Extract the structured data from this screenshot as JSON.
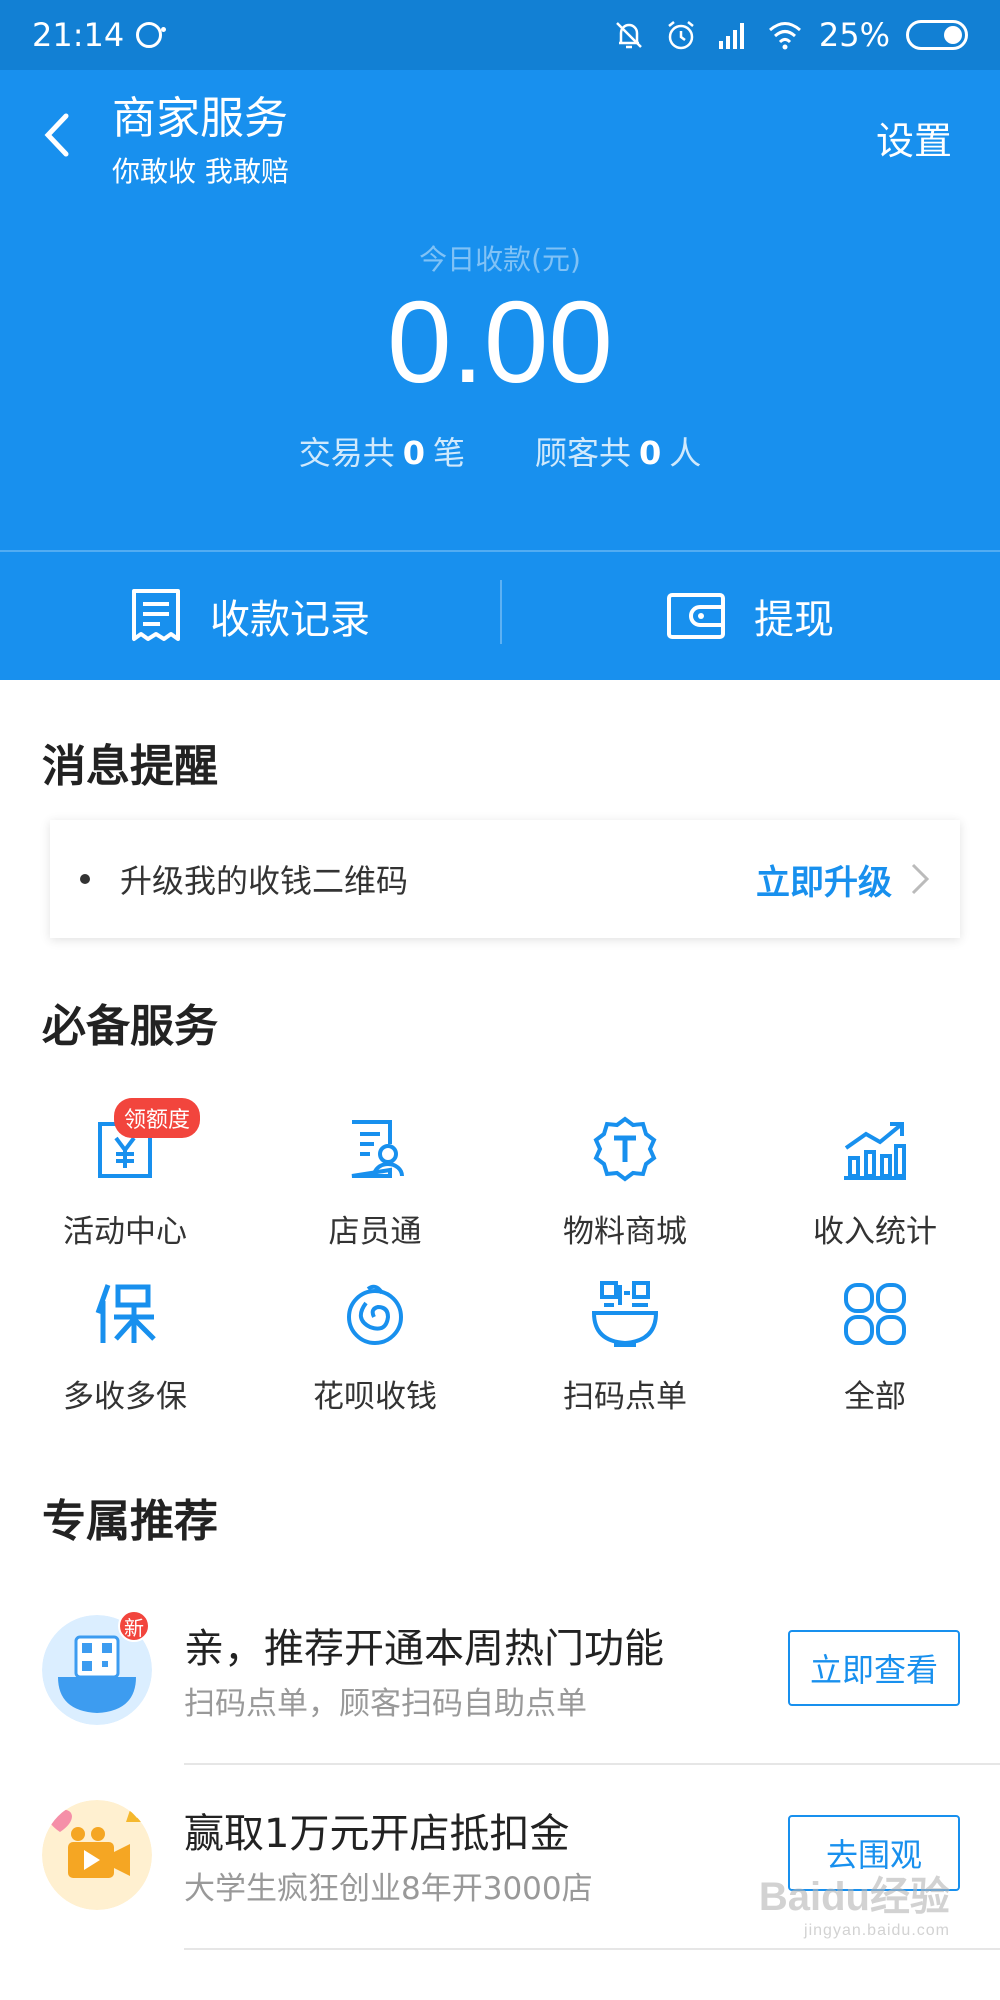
{
  "status_bar": {
    "time": "21:14",
    "battery": "25%"
  },
  "header": {
    "title": "商家服务",
    "subtitle": "你敢收 我敢赔",
    "settings_label": "设置",
    "today_label": "今日收款(元)",
    "amount": "0.00",
    "stats": {
      "trade_prefix": "交易共",
      "trade_count": "0",
      "trade_unit": "笔",
      "customer_prefix": "顾客共",
      "customer_count": "0",
      "customer_unit": "人"
    },
    "actions": [
      {
        "label": "收款记录",
        "icon": "receipt-icon"
      },
      {
        "label": "提现",
        "icon": "wallet-icon"
      }
    ]
  },
  "notices": {
    "title": "消息提醒",
    "items": [
      {
        "text": "升级我的收钱二维码",
        "link": "立即升级"
      }
    ]
  },
  "services": {
    "title": "必备服务",
    "items": [
      {
        "label": "活动中心",
        "icon": "activity-center-icon",
        "badge": "领额度"
      },
      {
        "label": "店员通",
        "icon": "clerk-icon"
      },
      {
        "label": "物料商城",
        "icon": "material-mall-icon"
      },
      {
        "label": "收入统计",
        "icon": "income-stats-icon"
      },
      {
        "label": "多收多保",
        "icon": "insurance-icon"
      },
      {
        "label": "花呗收钱",
        "icon": "huabei-icon"
      },
      {
        "label": "扫码点单",
        "icon": "scan-order-icon"
      },
      {
        "label": "全部",
        "icon": "all-services-icon"
      }
    ]
  },
  "recommend": {
    "title": "专属推荐",
    "items": [
      {
        "title": "亲，推荐开通本周热门功能",
        "subtitle": "扫码点单，顾客扫码自助点单",
        "button": "立即查看",
        "badge": "新"
      },
      {
        "title": "赢取1万元开店抵扣金",
        "subtitle": "大学生疯狂创业8年开3000店",
        "button": "去围观"
      }
    ]
  },
  "watermark": {
    "text": "Baidu经验",
    "sub": "jingyan.baidu.com"
  },
  "colors": {
    "primary": "#1890ee",
    "status_bar": "#1280d4",
    "badge_red": "#f2453d"
  }
}
